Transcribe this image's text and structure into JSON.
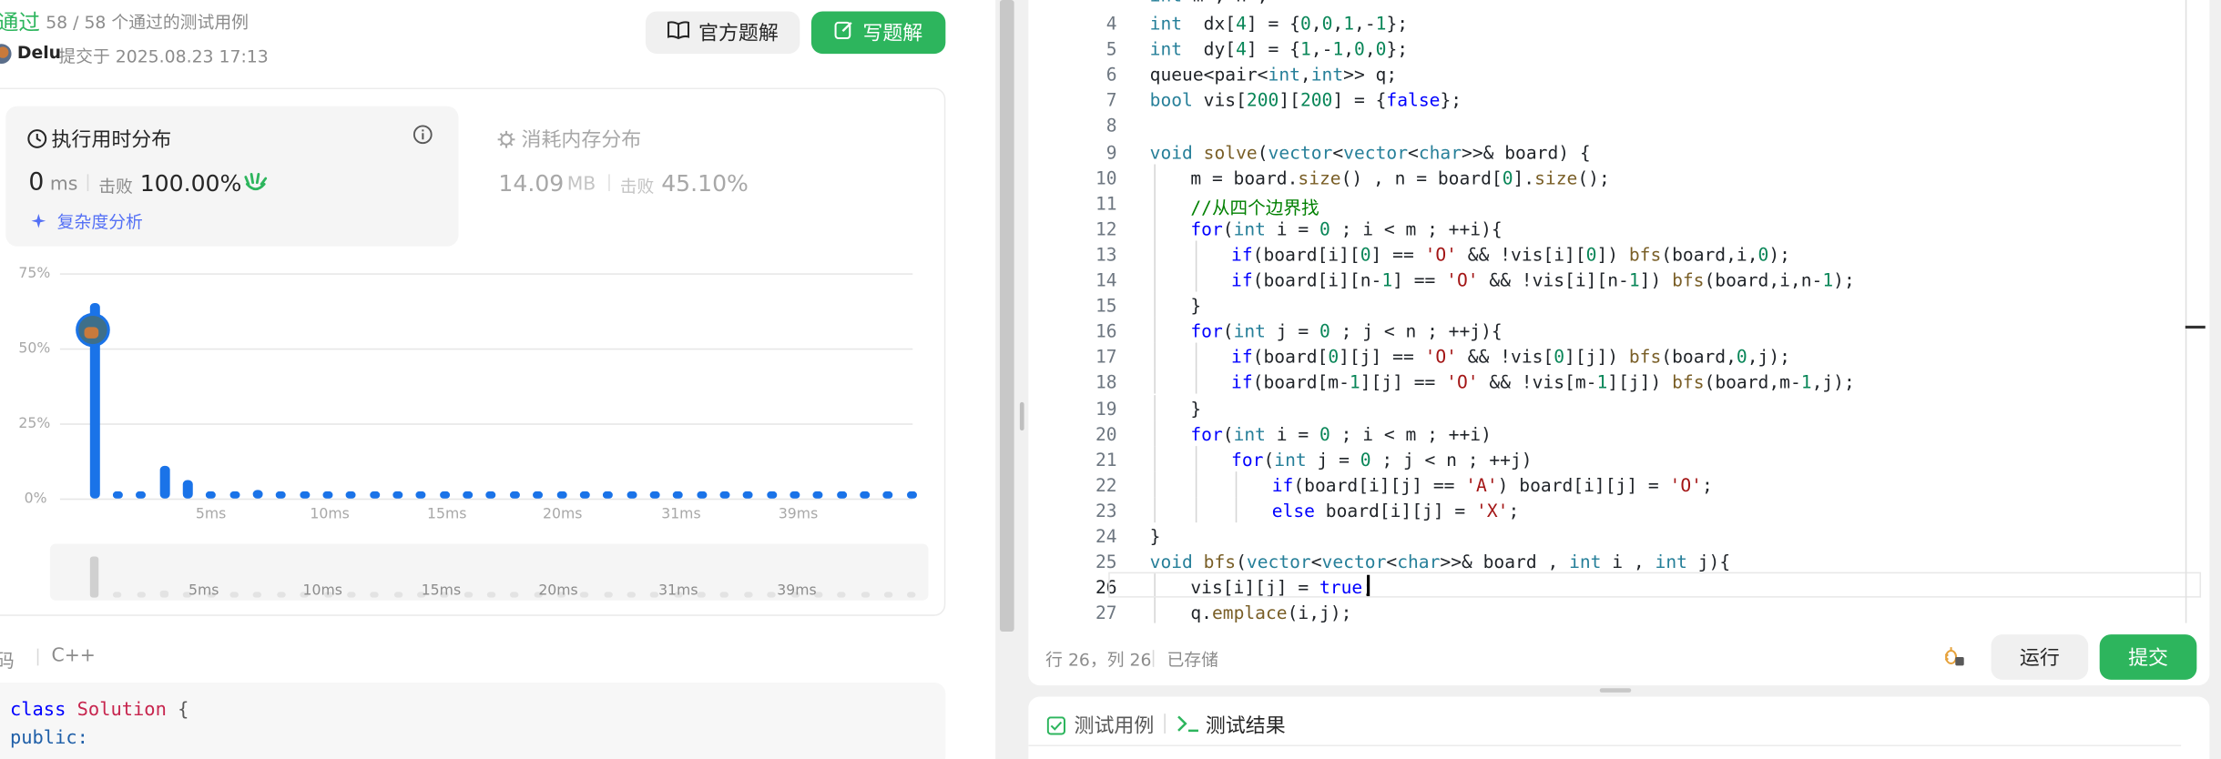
{
  "submission": {
    "status": "通过",
    "passed_text": "58 / 58 个通过的测试用例",
    "user": "Delu",
    "submitted_at": "提交于 2025.08.23 17:13",
    "official_solution_label": "官方题解",
    "write_solution_label": "写题解"
  },
  "runtime": {
    "title": "执行用时分布",
    "value": "0",
    "unit": "ms",
    "beat_label": "击败",
    "beat_value": "100.00%",
    "complexity_label": "复杂度分析"
  },
  "memory": {
    "title": "消耗内存分布",
    "value": "14.09",
    "unit": "MB",
    "beat_label": "击败",
    "beat_value": "45.10%"
  },
  "chart_data": {
    "type": "bar",
    "ylabels": [
      "75%",
      "50%",
      "25%",
      "0%"
    ],
    "xlabels": [
      "5ms",
      "10ms",
      "15ms",
      "20ms",
      "31ms",
      "39ms"
    ],
    "values": [
      65,
      1,
      1,
      11,
      6,
      1,
      1,
      3,
      1,
      1,
      1,
      1,
      1,
      1,
      1,
      1,
      1,
      1,
      1,
      1,
      1,
      1,
      1,
      1,
      1,
      1,
      1,
      1,
      1,
      1,
      1,
      1,
      1,
      1,
      1,
      1
    ],
    "ylim": [
      0,
      75
    ],
    "highlight_index": 0,
    "colors": {
      "bar": "#1a73e8",
      "grid": "#e6e6e6"
    }
  },
  "code_section": {
    "header": "代码",
    "header_visible": "码",
    "language": "C++",
    "lines": [
      "class Solution {",
      "public:"
    ]
  },
  "editor": {
    "lines": [
      {
        "n": 4,
        "indent": 1,
        "tokens": [
          [
            "ty",
            "int"
          ],
          [
            "",
            "  dx["
          ],
          [
            "num",
            "4"
          ],
          [
            "",
            "] = {"
          ],
          [
            "num",
            "0"
          ],
          [
            "",
            ","
          ],
          [
            "num",
            "0"
          ],
          [
            "",
            ","
          ],
          [
            "num",
            "1"
          ],
          [
            "",
            ",-"
          ],
          [
            "num",
            "1"
          ],
          [
            "",
            "};"
          ]
        ]
      },
      {
        "n": 5,
        "indent": 1,
        "tokens": [
          [
            "ty",
            "int"
          ],
          [
            "",
            "  dy["
          ],
          [
            "num",
            "4"
          ],
          [
            "",
            "] = {"
          ],
          [
            "num",
            "1"
          ],
          [
            "",
            ",-"
          ],
          [
            "num",
            "1"
          ],
          [
            "",
            ","
          ],
          [
            "num",
            "0"
          ],
          [
            "",
            ","
          ],
          [
            "num",
            "0"
          ],
          [
            "",
            "};"
          ]
        ]
      },
      {
        "n": 6,
        "indent": 1,
        "tokens": [
          [
            "",
            "queue<pair<"
          ],
          [
            "ty",
            "int"
          ],
          [
            "",
            ","
          ],
          [
            "ty",
            "int"
          ],
          [
            "",
            ">> q;"
          ]
        ]
      },
      {
        "n": 7,
        "indent": 1,
        "tokens": [
          [
            "ty",
            "bool"
          ],
          [
            "",
            " vis["
          ],
          [
            "num",
            "200"
          ],
          [
            "",
            "]["
          ],
          [
            "num",
            "200"
          ],
          [
            "",
            "] = {"
          ],
          [
            "kw",
            "false"
          ],
          [
            "",
            "};"
          ]
        ]
      },
      {
        "n": 8,
        "indent": 0,
        "tokens": []
      },
      {
        "n": 9,
        "indent": 1,
        "tokens": [
          [
            "ty",
            "void"
          ],
          [
            "",
            " "
          ],
          [
            "fn",
            "solve"
          ],
          [
            "",
            "("
          ],
          [
            "ty",
            "vector"
          ],
          [
            "",
            "<"
          ],
          [
            "ty",
            "vector"
          ],
          [
            "",
            "<"
          ],
          [
            "ty",
            "char"
          ],
          [
            "",
            ">>& board) {"
          ]
        ]
      },
      {
        "n": 10,
        "indent": 2,
        "tokens": [
          [
            "",
            "m = board."
          ],
          [
            "fn",
            "size"
          ],
          [
            "",
            "() , n = board["
          ],
          [
            "num",
            "0"
          ],
          [
            "",
            "]."
          ],
          [
            "fn",
            "size"
          ],
          [
            "",
            "();"
          ]
        ]
      },
      {
        "n": 11,
        "indent": 2,
        "tokens": [
          [
            "cm",
            "//从四个边界找"
          ]
        ]
      },
      {
        "n": 12,
        "indent": 2,
        "tokens": [
          [
            "kw",
            "for"
          ],
          [
            "",
            "("
          ],
          [
            "ty",
            "int"
          ],
          [
            "",
            " i = "
          ],
          [
            "num",
            "0"
          ],
          [
            "",
            " ; i < m ; ++i){"
          ]
        ]
      },
      {
        "n": 13,
        "indent": 3,
        "tokens": [
          [
            "kw",
            "if"
          ],
          [
            "",
            "(board[i]["
          ],
          [
            "num",
            "0"
          ],
          [
            "",
            "] == "
          ],
          [
            "str",
            "'O'"
          ],
          [
            "",
            " && !vis[i]["
          ],
          [
            "num",
            "0"
          ],
          [
            "",
            "]) "
          ],
          [
            "fn",
            "bfs"
          ],
          [
            "",
            "(board,i,"
          ],
          [
            "num",
            "0"
          ],
          [
            "",
            ");"
          ]
        ]
      },
      {
        "n": 14,
        "indent": 3,
        "tokens": [
          [
            "kw",
            "if"
          ],
          [
            "",
            "(board[i][n-"
          ],
          [
            "num",
            "1"
          ],
          [
            "",
            "] == "
          ],
          [
            "str",
            "'O'"
          ],
          [
            "",
            " && !vis[i][n-"
          ],
          [
            "num",
            "1"
          ],
          [
            "",
            "]) "
          ],
          [
            "fn",
            "bfs"
          ],
          [
            "",
            "(board,i,n-"
          ],
          [
            "num",
            "1"
          ],
          [
            "",
            ");"
          ]
        ]
      },
      {
        "n": 15,
        "indent": 2,
        "tokens": [
          [
            "",
            "}"
          ]
        ]
      },
      {
        "n": 16,
        "indent": 2,
        "tokens": [
          [
            "kw",
            "for"
          ],
          [
            "",
            "("
          ],
          [
            "ty",
            "int"
          ],
          [
            "",
            " j = "
          ],
          [
            "num",
            "0"
          ],
          [
            "",
            " ; j < n ; ++j){"
          ]
        ]
      },
      {
        "n": 17,
        "indent": 3,
        "tokens": [
          [
            "kw",
            "if"
          ],
          [
            "",
            "(board["
          ],
          [
            "num",
            "0"
          ],
          [
            "",
            "][j] == "
          ],
          [
            "str",
            "'O'"
          ],
          [
            "",
            " && !vis["
          ],
          [
            "num",
            "0"
          ],
          [
            "",
            "][j]) "
          ],
          [
            "fn",
            "bfs"
          ],
          [
            "",
            "(board,"
          ],
          [
            "num",
            "0"
          ],
          [
            "",
            ",j);"
          ]
        ]
      },
      {
        "n": 18,
        "indent": 3,
        "tokens": [
          [
            "kw",
            "if"
          ],
          [
            "",
            "(board[m-"
          ],
          [
            "num",
            "1"
          ],
          [
            "",
            "][j] == "
          ],
          [
            "str",
            "'O'"
          ],
          [
            "",
            " && !vis[m-"
          ],
          [
            "num",
            "1"
          ],
          [
            "",
            "][j]) "
          ],
          [
            "fn",
            "bfs"
          ],
          [
            "",
            "(board,m-"
          ],
          [
            "num",
            "1"
          ],
          [
            "",
            ",j);"
          ]
        ]
      },
      {
        "n": 19,
        "indent": 2,
        "tokens": [
          [
            "",
            "}"
          ]
        ]
      },
      {
        "n": 20,
        "indent": 2,
        "tokens": [
          [
            "kw",
            "for"
          ],
          [
            "",
            "("
          ],
          [
            "ty",
            "int"
          ],
          [
            "",
            " i = "
          ],
          [
            "num",
            "0"
          ],
          [
            "",
            " ; i < m ; ++i)"
          ]
        ]
      },
      {
        "n": 21,
        "indent": 3,
        "tokens": [
          [
            "kw",
            "for"
          ],
          [
            "",
            "("
          ],
          [
            "ty",
            "int"
          ],
          [
            "",
            " j = "
          ],
          [
            "num",
            "0"
          ],
          [
            "",
            " ; j < n ; ++j)"
          ]
        ]
      },
      {
        "n": 22,
        "indent": 4,
        "tokens": [
          [
            "kw",
            "if"
          ],
          [
            "",
            "(board[i][j] == "
          ],
          [
            "str",
            "'A'"
          ],
          [
            "",
            ") board[i][j] = "
          ],
          [
            "str",
            "'O'"
          ],
          [
            "",
            ";"
          ]
        ]
      },
      {
        "n": 23,
        "indent": 4,
        "tokens": [
          [
            "kw",
            "else"
          ],
          [
            "",
            " board[i][j] = "
          ],
          [
            "str",
            "'X'"
          ],
          [
            "",
            ";"
          ]
        ]
      },
      {
        "n": 24,
        "indent": 1,
        "tokens": [
          [
            "",
            "}"
          ]
        ]
      },
      {
        "n": 25,
        "indent": 1,
        "tokens": [
          [
            "ty",
            "void"
          ],
          [
            "",
            " "
          ],
          [
            "fn",
            "bfs"
          ],
          [
            "",
            "("
          ],
          [
            "ty",
            "vector"
          ],
          [
            "",
            "<"
          ],
          [
            "ty",
            "vector"
          ],
          [
            "",
            "<"
          ],
          [
            "ty",
            "char"
          ],
          [
            "",
            ">>& board , "
          ],
          [
            "ty",
            "int"
          ],
          [
            "",
            " i , "
          ],
          [
            "ty",
            "int"
          ],
          [
            "",
            " j){"
          ]
        ]
      },
      {
        "n": 26,
        "indent": 2,
        "tokens": [
          [
            "",
            "vis[i][j] = "
          ],
          [
            "kw",
            "true"
          ],
          [
            "",
            ";"
          ]
        ]
      },
      {
        "n": 27,
        "indent": 2,
        "tokens": [
          [
            "",
            "q."
          ],
          [
            "fn",
            "emplace"
          ],
          [
            "",
            "(i,j);"
          ]
        ]
      }
    ],
    "status_position": "行 26，列 26",
    "status_saved": "已存储",
    "run_label": "运行",
    "submit_label": "提交"
  },
  "bottom_tabs": {
    "testcase_label": "测试用例",
    "result_label": "测试结果"
  }
}
